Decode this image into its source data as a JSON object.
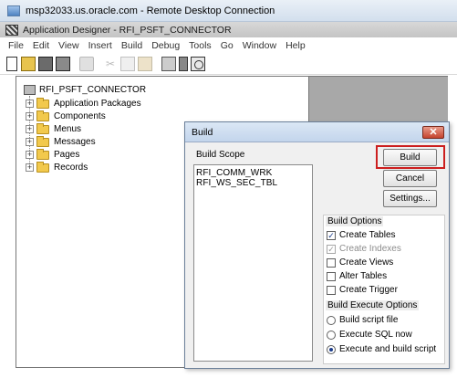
{
  "rdc": {
    "title": "msp32033.us.oracle.com - Remote Desktop Connection"
  },
  "app": {
    "title": "Application Designer - RFI_PSFT_CONNECTOR"
  },
  "menu": {
    "items": [
      "File",
      "Edit",
      "View",
      "Insert",
      "Build",
      "Debug",
      "Tools",
      "Go",
      "Window",
      "Help"
    ]
  },
  "toolbar": {
    "icons": [
      "new-icon",
      "open-icon",
      "save-icon",
      "save-all-icon",
      "print-icon",
      "cut-icon",
      "copy-icon",
      "paste-icon",
      "properties-icon",
      "project-icon",
      "build-icon"
    ]
  },
  "tree": {
    "root": "RFI_PSFT_CONNECTOR",
    "items": [
      "Application Packages",
      "Components",
      "Menus",
      "Messages",
      "Pages",
      "Records"
    ]
  },
  "dialog": {
    "title": "Build",
    "close_glyph": "✕",
    "scope_label": "Build Scope",
    "scope_items": [
      "RFI_COMM_WRK",
      "RFI_WS_SEC_TBL"
    ],
    "buttons": {
      "build": "Build",
      "cancel": "Cancel",
      "settings": "Settings..."
    },
    "options_label": "Build Options",
    "options": [
      {
        "label": "Create Tables",
        "checked": true,
        "enabled": true
      },
      {
        "label": "Create Indexes",
        "checked": true,
        "enabled": false
      },
      {
        "label": "Create Views",
        "checked": false,
        "enabled": true
      },
      {
        "label": "Alter Tables",
        "checked": false,
        "enabled": true
      },
      {
        "label": "Create Trigger",
        "checked": false,
        "enabled": true
      }
    ],
    "execute_label": "Build Execute Options",
    "execute_options": [
      {
        "label": "Build script file",
        "selected": false
      },
      {
        "label": "Execute SQL now",
        "selected": false
      },
      {
        "label": "Execute and build script",
        "selected": true
      }
    ],
    "check_glyph": "✓"
  },
  "colors": {
    "highlight": "#cc1e1e",
    "close_button": "#c4432e",
    "folder": "#f2c94c"
  }
}
